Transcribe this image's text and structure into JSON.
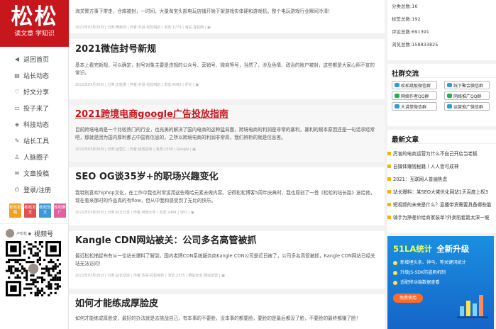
{
  "logo": {
    "chars": "松松",
    "slogan": "读文章 学知识"
  },
  "nav": [
    {
      "icon": "◀",
      "label": "返回首页"
    },
    {
      "icon": "▤",
      "label": "站长动态"
    },
    {
      "icon": "♡",
      "label": "好文分享"
    },
    {
      "icon": "▭",
      "label": "投子来了"
    },
    {
      "icon": "◈",
      "label": "科技动态"
    },
    {
      "icon": "✎",
      "label": "站长工具"
    },
    {
      "icon": "♙",
      "label": "人脉圈子"
    },
    {
      "icon": "✉",
      "label": "文章投稿"
    },
    {
      "icon": "⏻",
      "label": "登录/注册"
    }
  ],
  "side_tags": [
    {
      "text": "松松投稿",
      "color": "#f0a020"
    },
    {
      "text": "松松发文",
      "color": "#e05050"
    },
    {
      "text": "松松软文",
      "color": "#3a9ad9"
    },
    {
      "text": "松松推广",
      "color": "#e060a0"
    }
  ],
  "qr": {
    "name": "卢松松 ●",
    "label": "视频号"
  },
  "posts": [
    {
      "title": "",
      "excerpt": "海关警方事下带走，仓库被封，一时间，大量淘宝头部电玩店铺开始下架游戏实体硬和游戏机，整个电玩游戏行业瞬间冷清！",
      "meta": "2021年03月30日 | 分类:微新闻 | 作者:杰哥-松松喝奶 | 浏览:1779 | 海关,互联网 | ▣"
    },
    {
      "title": "2021微信封号新规",
      "excerpt": "基本上看完新规，可以确定，封号对象主要是违规的公众号、营销号、微商等号，当然了，涉及色情、政治的账户被封，这些都是大家心照不宣的常识。",
      "meta": "2021年03月30日 | 分类:正能量 | 作者:杰哥-松松喝奶 | 浏览:4083 | 评论 | ▣"
    },
    {
      "title": "2021跨境电商google广告投放指南",
      "excerpt": "目前跨境电商是一个比较热门的行业，也充美的解决了国内电商的这种猛局面，跨境电商的利润是非常的暴利，暴利的根本原因还是一句话求经常吧，那就是因为国内厚利都占中国有信息的，之所以跨境电商的利润非常高，我们辨析的就是信息差。",
      "meta": "2021年03月30日 | 分类:运营汇 | 作者:谈省招商 | 浏览:1509 | Google | ▣"
    },
    {
      "title": "SEO OG谈35岁+的职场兴趣变化",
      "excerpt": "我特别喜欢hiphop文化，在工作中我也时常运用这些嘻哈元素去做内容。记得松松博客5周年庆典时，我也原创了一首《松松的站长路》送给他，现在看来那时的作品真的有flow，但从中我和感受到了无比的快乐。",
      "meta": "2021年03月30日 | 分类:好文分享 | 作者:林锴大学 | 浏览:2484 | SEO | ▣"
    },
    {
      "title": "Kangle CDN网站被关：公司多名高管被抓",
      "excerpt": "最近松松捕捉布有从一位站长爆料了解到，国内老牌CDN系统服务商Kangle CDN公司是近日被了，公司多名高管被抓，Kangle CDN网站已经关站无法访问！",
      "meta": "2021年03月30日 | 分类:站长动态 | 作者:杰哥-松松喝奶 | 浏览:2375 | 网站安全,网站运营 | ▣"
    },
    {
      "title": "如何才能练成厚脸皮",
      "excerpt": "如何才能练成厚脸皮，最好的办法就是去挑战自己，有本事的不要脸，没本事的都要脸，要脸的是最后都没了脸，不要脸的最终都赚了脸！",
      "meta": ""
    }
  ],
  "stats": [
    "分类总数:16",
    "标签总数:192",
    "评论总数:691391",
    "浏览总数:158833825"
  ],
  "social": {
    "title": "社群交流",
    "buttons": [
      {
        "label": "松松跳板微信群",
        "color": "#27a0e0"
      },
      {
        "label": "线下聚会微信群",
        "color": "#27a0e0"
      },
      {
        "label": "网络作者QQ群",
        "color": "#21b24b"
      },
      {
        "label": "网络推广QQ群",
        "color": "#21b24b"
      },
      {
        "label": "大讲堂微信群",
        "color": "#27a0e0"
      },
      {
        "label": "运营推广微信群",
        "color": "#27a0e0"
      }
    ]
  },
  "latest": {
    "title": "最新文章",
    "items": [
      "厉害的电商运营为什么不自己开店当老板",
      "自媒体赚钱秘籍丨人人皆可成神",
      "2021：互联网人普遍焦虑",
      "站长爆料：某SEO大佬优化网站1天百度上权3",
      "短视频的未来是什么？直播带货需要具备哪些能",
      "骑手为挣差价给商家装单?外卖陷套路太深一坡"
    ]
  },
  "ad": {
    "title": "51LA统计",
    "title2": "全新升级",
    "lines": [
      "新增埋头条、神马、等关键词统计",
      "升级JS-SDK防盗刷机制",
      "适配移动端数据查看"
    ],
    "cta": "免费使用"
  }
}
